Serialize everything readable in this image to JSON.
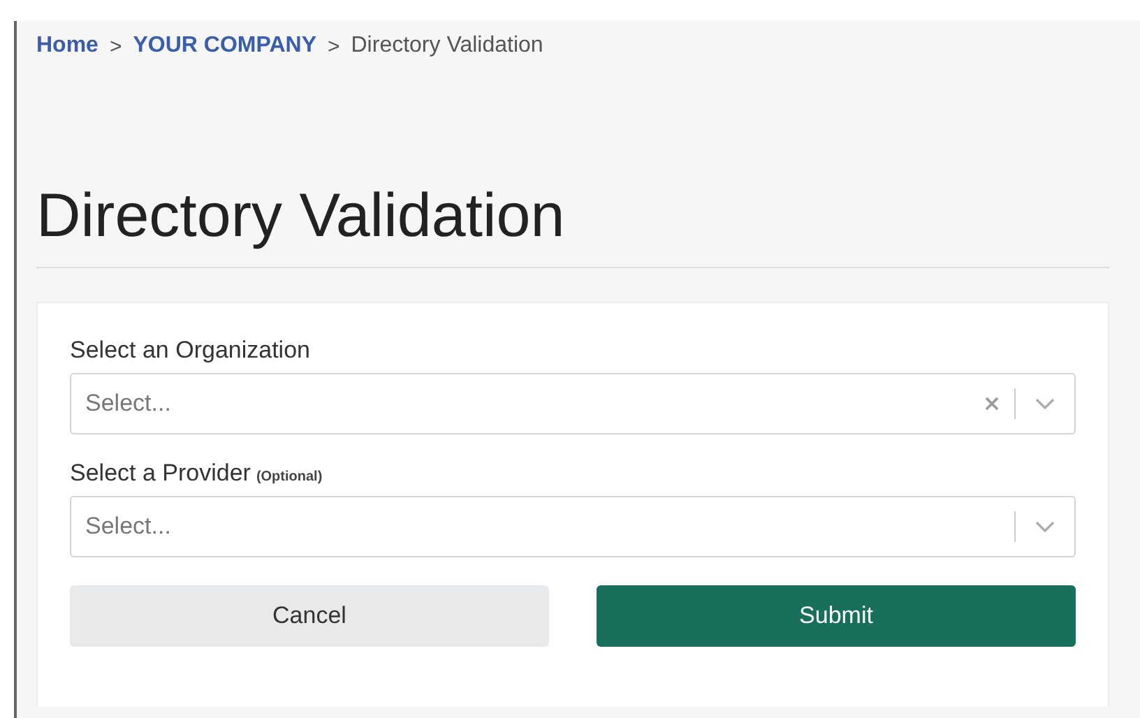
{
  "breadcrumb": [
    {
      "label": "Home",
      "link": true
    },
    {
      "label": "YOUR COMPANY",
      "link": true
    },
    {
      "label": "Directory Validation",
      "link": false
    }
  ],
  "separator": ">",
  "title": "Directory Validation",
  "fields": [
    {
      "label": "Select an Organization",
      "placeholder": "Select...",
      "clearable": true
    },
    {
      "label": "Select a Provider",
      "note": "(Optional)",
      "placeholder": "Select...",
      "clearable": false
    }
  ],
  "buttons": [
    {
      "label": "Cancel",
      "kind": "secondary"
    },
    {
      "label": "Submit",
      "kind": "primary"
    }
  ]
}
